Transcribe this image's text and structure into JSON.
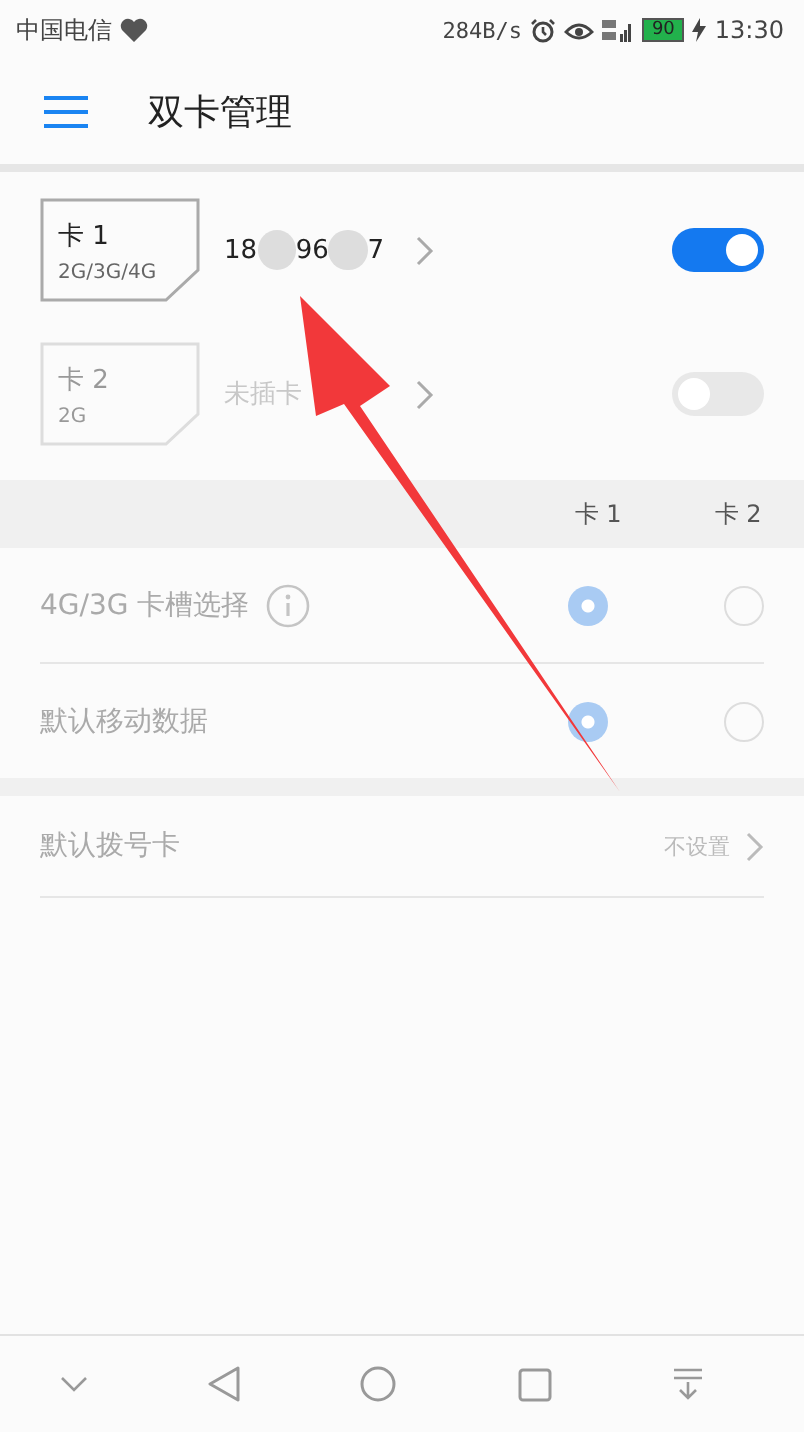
{
  "status_bar": {
    "carrier": "中国电信",
    "speed": "284B/s",
    "battery": "90",
    "time": "13:30"
  },
  "app_bar": {
    "title": "双卡管理"
  },
  "sim_cards": [
    {
      "name": "卡 1",
      "networks": "2G/3G/4G",
      "number_parts": [
        "18",
        "96",
        "7"
      ],
      "on": true,
      "disabled": false
    },
    {
      "name": "卡 2",
      "networks": "2G",
      "status": "未插卡",
      "on": false,
      "disabled": true
    }
  ],
  "slot_header": [
    "卡 1",
    "卡 2"
  ],
  "slot_rows": [
    {
      "label": "4G/3G 卡槽选择",
      "info": true,
      "disabled": true,
      "options": [
        {
          "selected": true
        },
        {
          "selected": false
        }
      ]
    },
    {
      "label": "默认移动数据",
      "info": false,
      "disabled": true,
      "options": [
        {
          "selected": true
        },
        {
          "selected": false
        }
      ]
    }
  ],
  "dial_card": {
    "label": "默认拨号卡",
    "value": "不设置",
    "disabled": true
  }
}
